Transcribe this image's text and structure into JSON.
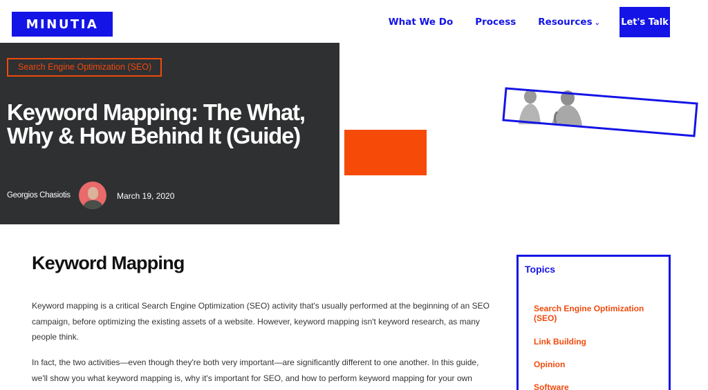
{
  "header": {
    "logo_text": "MINUTIA",
    "nav": [
      {
        "label": "What We Do"
      },
      {
        "label": "Process"
      },
      {
        "label": "Resources",
        "icon": "chevron-down-icon"
      }
    ],
    "cta_label": "Let's Talk"
  },
  "hero": {
    "category": "Search Engine Optimization (SEO)",
    "title": "Keyword Mapping: The What, Why & How Behind It (Guide)",
    "author": "Georgios Chasiotis",
    "date": "March 19, 2020"
  },
  "article": {
    "heading": "Keyword Mapping",
    "paragraphs": [
      "Keyword mapping is a critical Search Engine Optimization (SEO) activity that's usually performed at the beginning of an SEO campaign, before optimizing the existing assets of a website. However, keyword mapping isn't keyword research, as many people think.",
      "In fact, the two activities—even though they're both very important—are significantly different to one another. In this guide, we'll show you what keyword mapping is, why it's important for SEO, and how to perform keyword mapping for your own"
    ]
  },
  "sidebar": {
    "title": "Topics",
    "items": [
      {
        "label": "Search Engine Optimization (SEO)"
      },
      {
        "label": "Link Building"
      },
      {
        "label": "Opinion"
      },
      {
        "label": "Software"
      }
    ]
  },
  "colors": {
    "brand_blue": "#1414e6",
    "accent_orange": "#f04a0c",
    "hero_bg": "#2f3032"
  }
}
